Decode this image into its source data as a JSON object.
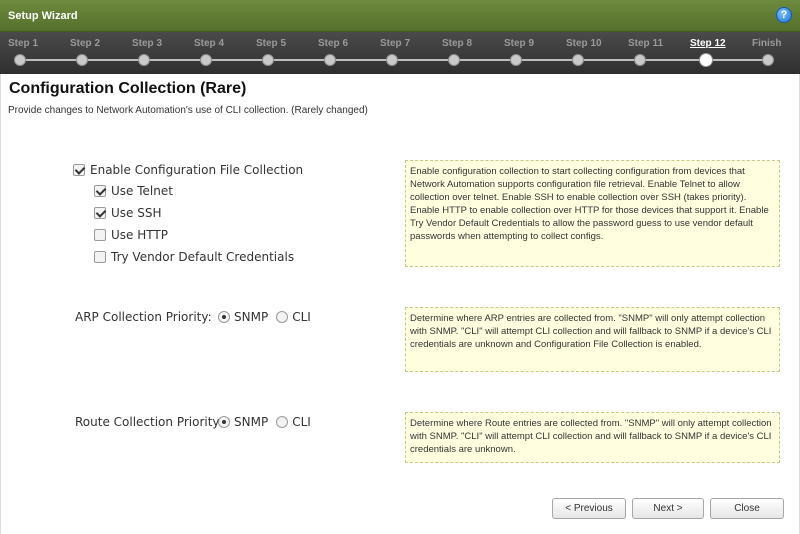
{
  "window": {
    "title": "Setup Wizard",
    "help_icon": "help-icon"
  },
  "steps": [
    {
      "label": "Step 1"
    },
    {
      "label": "Step 2"
    },
    {
      "label": "Step 3"
    },
    {
      "label": "Step 4"
    },
    {
      "label": "Step 5"
    },
    {
      "label": "Step 6"
    },
    {
      "label": "Step 7"
    },
    {
      "label": "Step 8"
    },
    {
      "label": "Step 9"
    },
    {
      "label": "Step 10"
    },
    {
      "label": "Step 11"
    },
    {
      "label": "Step 12"
    },
    {
      "label": "Finish"
    }
  ],
  "current_step": "Step 12",
  "page": {
    "title": "Configuration Collection (Rare)",
    "description": "Provide changes to Network Automation's use of CLI collection. (Rarely changed)"
  },
  "config_collection": {
    "enable": {
      "label": "Enable Configuration File Collection",
      "checked": true
    },
    "telnet": {
      "label": "Use Telnet",
      "checked": true
    },
    "ssh": {
      "label": "Use SSH",
      "checked": true
    },
    "http": {
      "label": "Use HTTP",
      "checked": false
    },
    "vendor": {
      "label": "Try Vendor Default Credentials",
      "checked": false
    },
    "help": "Enable configuration collection to start collecting configuration from devices that Network Automation supports configuration file retrieval. Enable Telnet to allow collection over telnet. Enable SSH to enable collection over SSH (takes priority). Enable HTTP to enable collection over HTTP for those devices that support it. Enable Try Vendor Default Credentials to allow the password guess to use vendor default passwords when attempting to collect configs."
  },
  "arp": {
    "label": "ARP Collection Priority:",
    "options": [
      "SNMP",
      "CLI"
    ],
    "selected": "SNMP",
    "help": "Determine where ARP entries are collected from. \"SNMP\" will only attempt collection with SNMP. \"CLI\" will attempt CLI collection and will fallback to SNMP if a device's CLI credentials are unknown and Configuration File Collection is enabled."
  },
  "route": {
    "label": "Route Collection Priority:",
    "options": [
      "SNMP",
      "CLI"
    ],
    "selected": "SNMP",
    "help": "Determine where Route entries are collected from. \"SNMP\" will only attempt collection with SNMP. \"CLI\" will attempt CLI collection and will fallback to SNMP if a device's CLI credentials are unknown."
  },
  "buttons": {
    "previous": "< Previous",
    "next": "Next >",
    "close": "Close"
  }
}
